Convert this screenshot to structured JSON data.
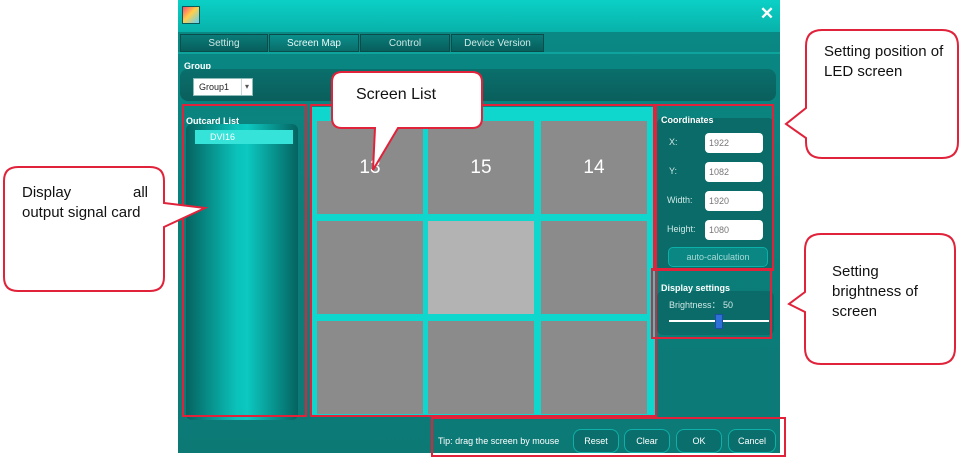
{
  "window": {
    "close_icon": "close-x-icon"
  },
  "tabs": [
    "Setting",
    "Screen Map",
    "Control",
    "Device Version"
  ],
  "group": {
    "label": "Group",
    "selected": "Group1"
  },
  "outcard": {
    "label": "Outcard List",
    "items": [
      "DVI16"
    ]
  },
  "screens": {
    "cells": [
      "13",
      "15",
      "14",
      "",
      "",
      "",
      "",
      "",
      ""
    ]
  },
  "coordinates": {
    "label": "Coordinates",
    "x_label": "X:",
    "x_value": "1922",
    "y_label": "Y:",
    "y_value": "1082",
    "width_label": "Width:",
    "width_value": "1920",
    "height_label": "Height:",
    "height_value": "1080",
    "auto_button": "auto-calculation"
  },
  "display": {
    "label": "Display settings",
    "brightness_label": "Brightness",
    "brightness_value": "50",
    "brightness_fraction": 0.5
  },
  "bottom": {
    "tip": "Tip: drag the screen by mouse",
    "reset": "Reset",
    "clear": "Clear",
    "ok": "OK",
    "cancel": "Cancel"
  },
  "annotations": {
    "screen_list": "Screen List",
    "display_all_word1": "Display",
    "display_all_word2": "all",
    "display_all_rest": "output signal card",
    "position": "Setting position of LED screen",
    "brightness": "Setting brightness of screen"
  },
  "colors": {
    "accent": "#0bd0c6",
    "panel": "#0a6b68",
    "highlight": "#e0223a"
  }
}
